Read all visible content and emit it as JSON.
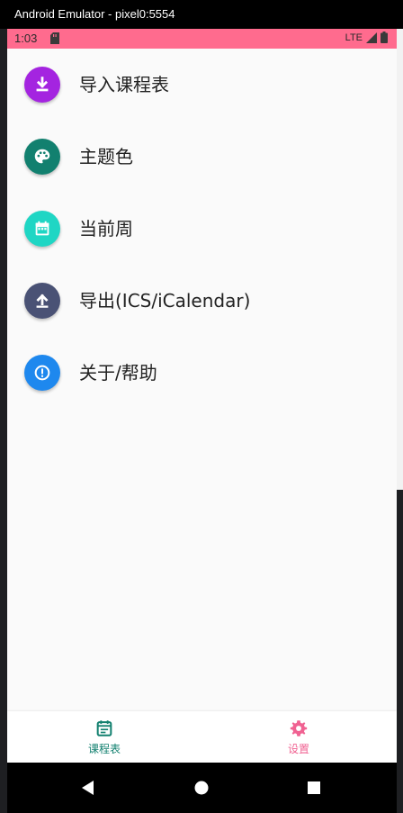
{
  "window": {
    "title": "Android Emulator - pixel0:5554"
  },
  "status_bar": {
    "time": "1:03",
    "network": "LTE",
    "color": "#ff6b8e"
  },
  "menu": [
    {
      "label": "导入课程表",
      "icon": "download-icon",
      "color": "#a424e0"
    },
    {
      "label": "主题色",
      "icon": "palette-icon",
      "color": "#12806f"
    },
    {
      "label": "当前周",
      "icon": "calendar-icon",
      "color": "#1fd6c4"
    },
    {
      "label": "导出(ICS/iCalendar)",
      "icon": "upload-icon",
      "color": "#4a5275"
    },
    {
      "label": "关于/帮助",
      "icon": "info-icon",
      "color": "#1e88ee"
    }
  ],
  "bottom_nav": {
    "tabs": [
      {
        "label": "课程表",
        "icon": "schedule-icon",
        "color": "#12806f"
      },
      {
        "label": "设置",
        "icon": "gear-icon",
        "color": "#f06292",
        "selected": true
      }
    ]
  },
  "system_nav": {
    "buttons": [
      "back",
      "home",
      "recents"
    ]
  }
}
